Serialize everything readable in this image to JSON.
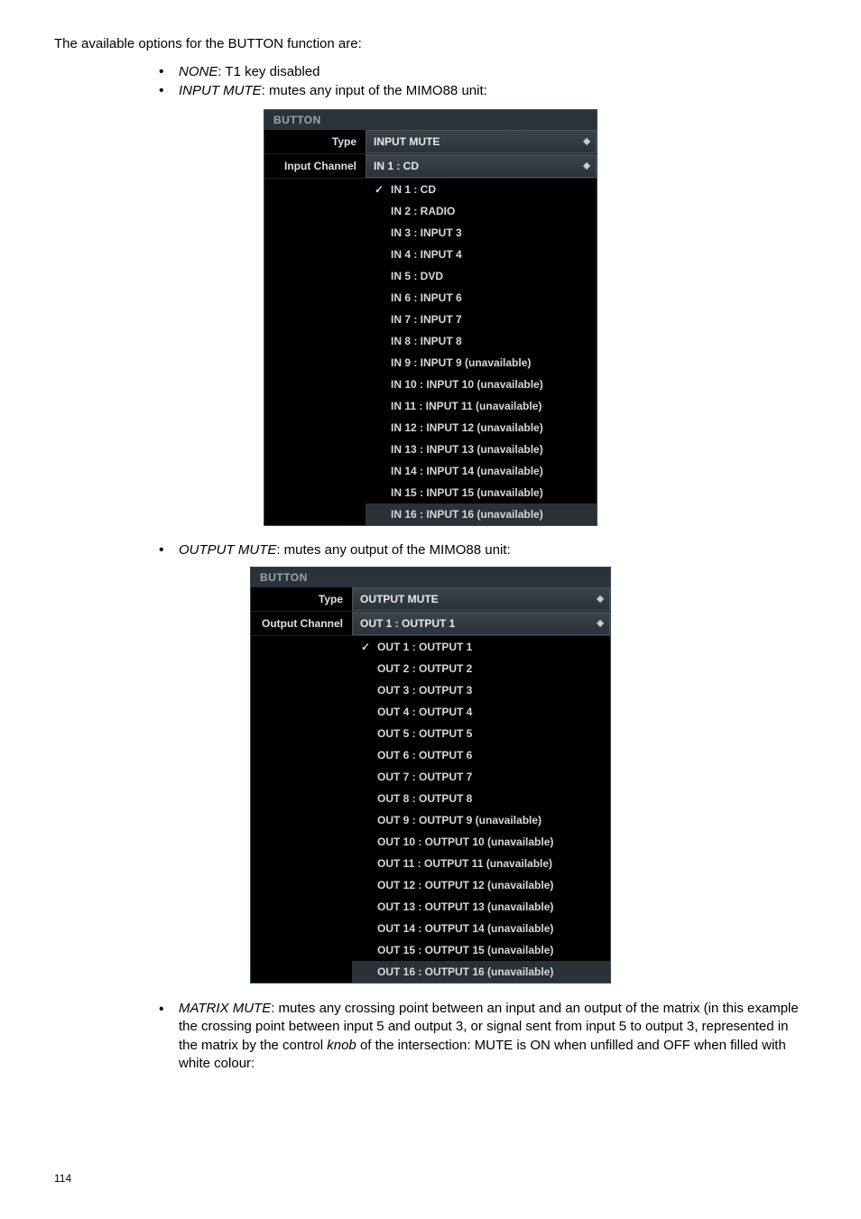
{
  "intro": "The available options for the BUTTON function are:",
  "bullets1": [
    {
      "term": "NONE",
      "rest": ": T1 key disabled"
    },
    {
      "term": "INPUT MUTE",
      "rest": ": mutes any input of the MIMO88 unit:"
    }
  ],
  "panel1": {
    "header": "BUTTON",
    "type_label": "Type",
    "type_value": "INPUT MUTE",
    "channel_label": "Input Channel",
    "channel_value": "IN 1 : CD",
    "items": [
      "IN 1 : CD",
      "IN 2 : RADIO",
      "IN 3 : INPUT 3",
      "IN 4 : INPUT 4",
      "IN 5 : DVD",
      "IN 6 : INPUT 6",
      "IN 7 : INPUT 7",
      "IN 8 : INPUT 8",
      "IN 9 : INPUT 9 (unavailable)",
      "IN 10 : INPUT 10 (unavailable)",
      "IN 11 : INPUT 11 (unavailable)",
      "IN 12 : INPUT 12 (unavailable)",
      "IN 13 : INPUT 13 (unavailable)",
      "IN 14 : INPUT 14 (unavailable)",
      "IN 15 : INPUT 15 (unavailable)",
      "IN 16 : INPUT 16 (unavailable)"
    ]
  },
  "bullets2": [
    {
      "term": "OUTPUT MUTE",
      "rest": ": mutes any output of the MIMO88 unit:"
    }
  ],
  "panel2": {
    "header": "BUTTON",
    "type_label": "Type",
    "type_value": "OUTPUT MUTE",
    "channel_label": "Output Channel",
    "channel_value": "OUT 1 : OUTPUT 1",
    "items": [
      "OUT 1 : OUTPUT 1",
      "OUT 2 : OUTPUT 2",
      "OUT 3 : OUTPUT 3",
      "OUT 4 : OUTPUT 4",
      "OUT 5 : OUTPUT 5",
      "OUT 6 : OUTPUT 6",
      "OUT 7 : OUTPUT 7",
      "OUT 8 : OUTPUT 8",
      "OUT 9 : OUTPUT 9 (unavailable)",
      "OUT 10 : OUTPUT 10 (unavailable)",
      "OUT 11 : OUTPUT 11 (unavailable)",
      "OUT 12 : OUTPUT 12 (unavailable)",
      "OUT 13 : OUTPUT 13 (unavailable)",
      "OUT 14 : OUTPUT 14 (unavailable)",
      "OUT 15 : OUTPUT 15 (unavailable)",
      "OUT 16 : OUTPUT 16 (unavailable)"
    ]
  },
  "matrix": {
    "term": "MATRIX MUTE",
    "rest": ": mutes any crossing point between an input and an output of the matrix (in this example the crossing point between input 5 and output 3, or signal sent from input 5 to output 3, represented in the matrix by the control ",
    "knob": "knob",
    "rest2": " of the intersection: MUTE is ON when unfilled and OFF when filled with white colour:"
  },
  "page_no": "114"
}
